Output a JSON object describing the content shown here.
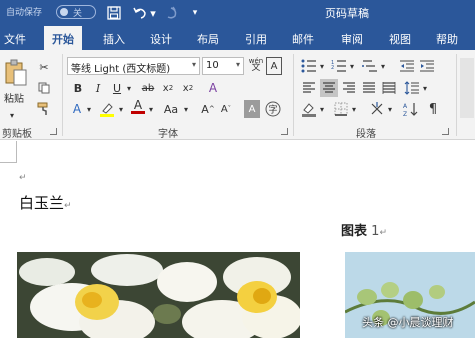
{
  "titlebar": {
    "autosave_label": "自动保存",
    "autosave_state": "关",
    "doc_title": "页码草稿"
  },
  "menu": [
    "文件",
    "开始",
    "插入",
    "设计",
    "布局",
    "引用",
    "邮件",
    "审阅",
    "视图",
    "帮助"
  ],
  "ribbon": {
    "clipboard": {
      "paste_label": "粘贴",
      "group_label": "剪贴板"
    },
    "font": {
      "font_name": "等线 Light (西文标题)",
      "font_size": "10",
      "wen_label": "wén",
      "group_label": "字体"
    },
    "paragraph": {
      "group_label": "段落"
    }
  },
  "document": {
    "heading": "白玉兰",
    "caption_label": "图表",
    "caption_number": "1",
    "watermark": "头条 @小晨谈理财"
  },
  "colors": {
    "brand": "#2b579a",
    "highlight": "#ffff00",
    "font_color": "#c00000"
  }
}
